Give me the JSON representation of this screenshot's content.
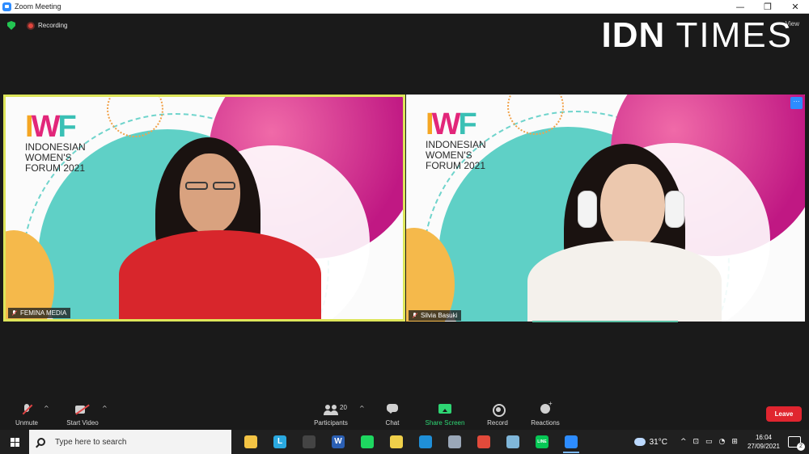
{
  "window": {
    "title": "Zoom Meeting",
    "controls": [
      "—",
      "❐",
      "✕"
    ]
  },
  "status": {
    "recording_label": "Recording",
    "view_label": "View"
  },
  "watermark": {
    "brand_left": "IDN",
    "brand_right": "TIMES"
  },
  "tiles": [
    {
      "name": "FEMINA MEDIA",
      "logo_letters": [
        "I",
        "W",
        "F"
      ],
      "logo_sub": [
        "INDONESIAN",
        "WOMEN'S",
        "FORUM 2021"
      ],
      "active_speaker": true
    },
    {
      "name": "Silvia Basuki",
      "logo_letters": [
        "I",
        "W",
        "F"
      ],
      "logo_sub": [
        "INDONESIAN",
        "WOMEN'S",
        "FORUM 2021"
      ],
      "active_speaker": false
    }
  ],
  "tile_more_label": "···",
  "toolbar": {
    "unmute": "Unmute",
    "start_video": "Start Video",
    "participants": "Participants",
    "participants_count": "20",
    "chat": "Chat",
    "share_screen": "Share Screen",
    "record": "Record",
    "reactions": "Reactions",
    "leave": "Leave",
    "caret": "^"
  },
  "taskbar": {
    "search_placeholder": "Type here to search",
    "apps": [
      {
        "name": "file-explorer",
        "glyph": "",
        "color": "#f3c344"
      },
      {
        "name": "l-app",
        "glyph": "L",
        "color": "#2aa9e0"
      },
      {
        "name": "store",
        "glyph": "",
        "color": "#444444"
      },
      {
        "name": "word",
        "glyph": "W",
        "color": "#2b5fb3"
      },
      {
        "name": "spotify",
        "glyph": "",
        "color": "#1ed760"
      },
      {
        "name": "sticky-notes",
        "glyph": "",
        "color": "#f0d04a"
      },
      {
        "name": "edge",
        "glyph": "",
        "color": "#1f8fd8"
      },
      {
        "name": "paint",
        "glyph": "",
        "color": "#9aa7b8"
      },
      {
        "name": "chrome",
        "glyph": "",
        "color": "#e24a3b"
      },
      {
        "name": "notepad",
        "glyph": "",
        "color": "#7fb6d9"
      },
      {
        "name": "line",
        "glyph": "LINE",
        "color": "#06c755"
      },
      {
        "name": "zoom",
        "glyph": "",
        "color": "#2d8cff"
      }
    ],
    "temperature": "31°C",
    "time": "16:04",
    "date": "27/09/2021",
    "notification_count": "2",
    "tray_symbols": [
      "^",
      "⊡",
      "▭",
      "◔",
      "⊞"
    ]
  },
  "colors": {
    "active_border": "#dde55a",
    "accent_blue": "#2d8cff",
    "share_green": "#2ed573",
    "leave_red": "#e0252f"
  }
}
